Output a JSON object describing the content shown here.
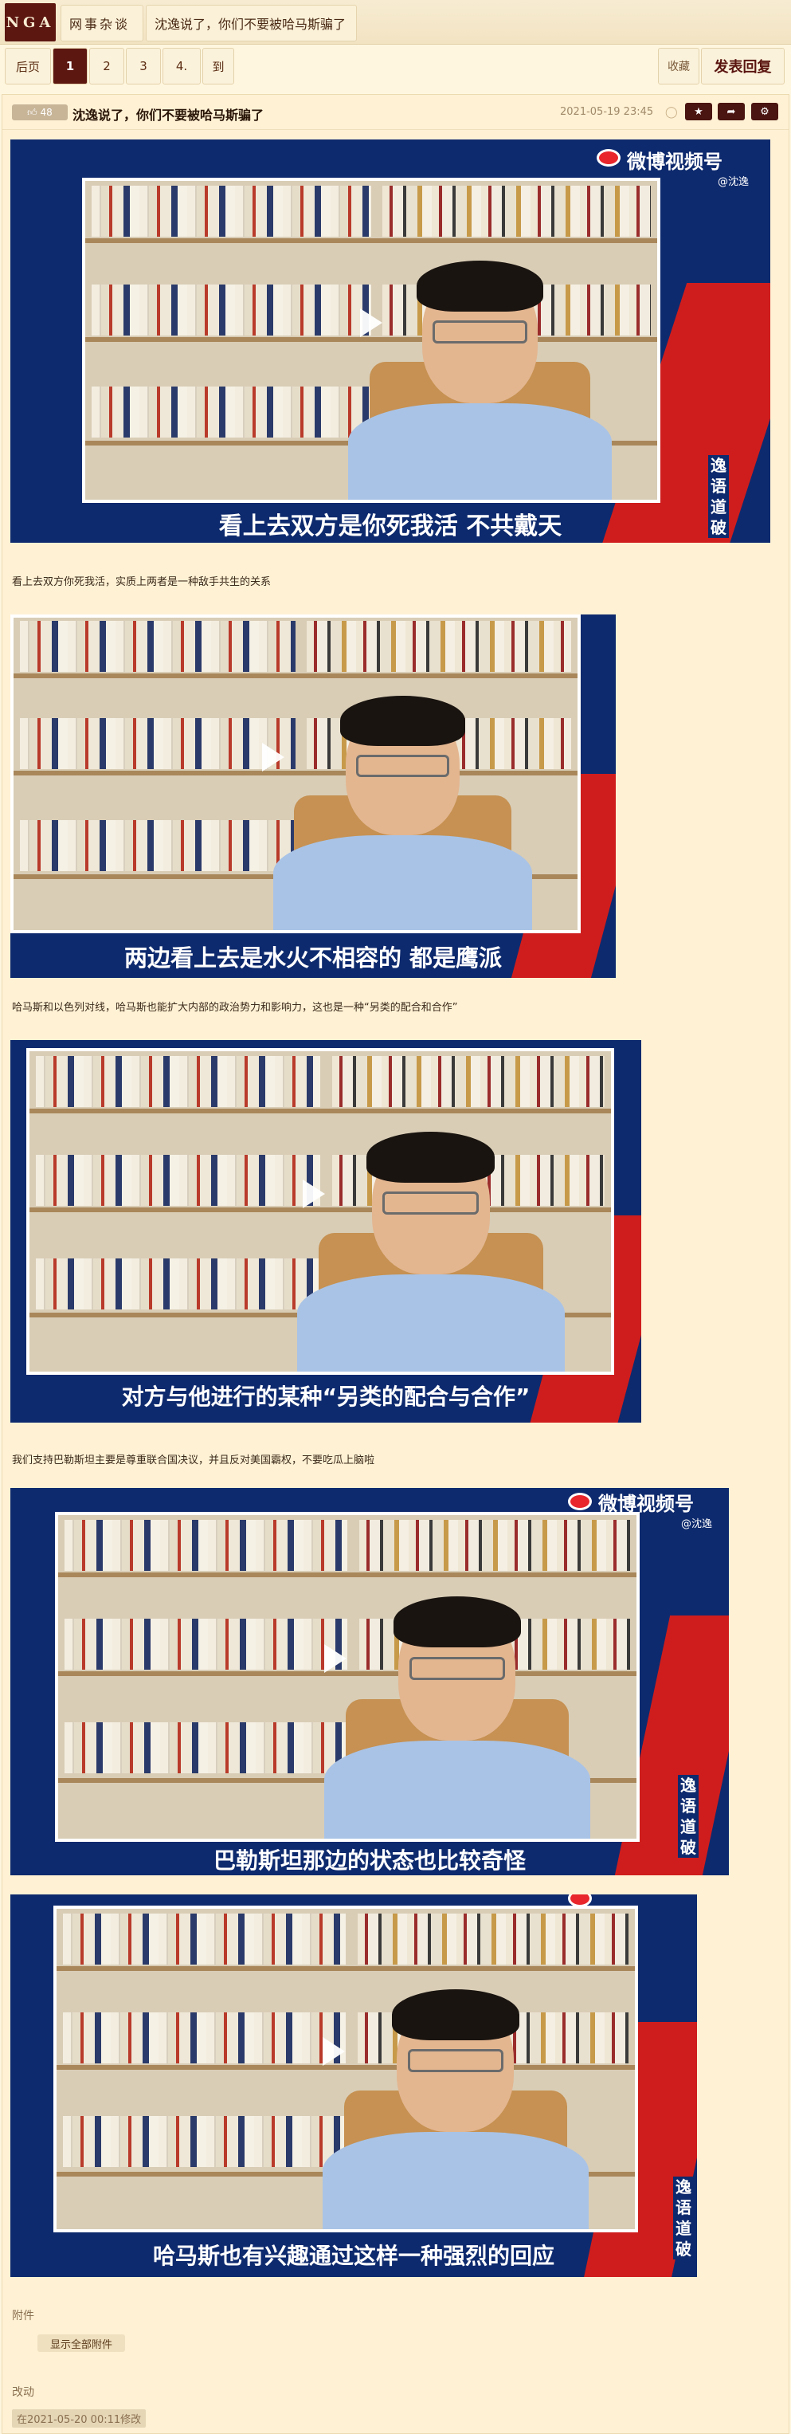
{
  "header": {
    "logo": "NGA",
    "crumb_forum": "网事杂谈",
    "crumb_thread": "沈逸说了，你们不要被哈马斯骗了"
  },
  "pager": {
    "prev_label": "后页",
    "pages": [
      "1",
      "2",
      "3",
      "4."
    ],
    "goto_label": "到",
    "fav_label": "收藏",
    "reply_label": "发表回复"
  },
  "post": {
    "likes": "48",
    "title": "沈逸说了，你们不要被哈马斯骗了",
    "date": "2021-05-19 23:45",
    "images": [
      {
        "caption": "看上去双方是你死我活 不共戴天",
        "watermark": "微博视频号",
        "handle": "@沈逸",
        "vertical": "逸语道破"
      },
      {
        "caption": "两边看上去是水火不相容的 都是鹰派"
      },
      {
        "caption": "对方与他进行的某种“另类的配合与合作”"
      },
      {
        "caption": "巴勒斯坦那边的状态也比较奇怪",
        "watermark": "微博视频号",
        "handle": "@沈逸",
        "vertical": "逸语道破"
      },
      {
        "caption": "哈马斯也有兴趣通过这样一种强烈的回应",
        "vertical": "逸语道破"
      }
    ],
    "paragraphs": [
      "看上去双方你死我活，实质上两者是一种敌手共生的关系",
      "哈马斯和以色列对线，哈马斯也能扩大内部的政治势力和影响力，这也是一种“另类的配合和合作”",
      "我们支持巴勒斯坦主要是尊重联合国决议，并且反对美国霸权，不要吃瓜上脑啦"
    ],
    "attachments_label": "附件",
    "show_attachments": "显示全部附件",
    "edit_label": "改动",
    "edit_note": "在2021-05-20 00:11修改"
  },
  "colors": {
    "brand": "#5d1711",
    "frame_blue": "#0e2a6e",
    "accent_red": "#cf1d1d",
    "page_bg": "#fff6df"
  },
  "icons": [
    "share-icon",
    "star-icon",
    "gear-icon",
    "thumb-icon",
    "play-icon",
    "weibo-eye-icon"
  ]
}
